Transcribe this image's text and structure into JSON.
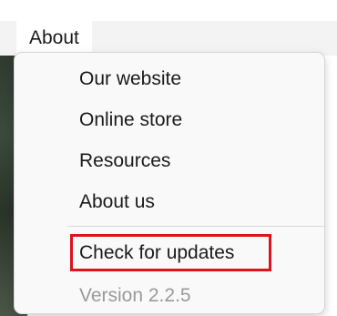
{
  "menubar": {
    "active_menu": "About"
  },
  "dropdown": {
    "items": [
      {
        "label": "Our website"
      },
      {
        "label": "Online store"
      },
      {
        "label": "Resources"
      },
      {
        "label": "About us"
      }
    ],
    "check_updates_label": "Check for updates",
    "version_label": "Version 2.2.5",
    "highlight_color": "#e0121c"
  }
}
